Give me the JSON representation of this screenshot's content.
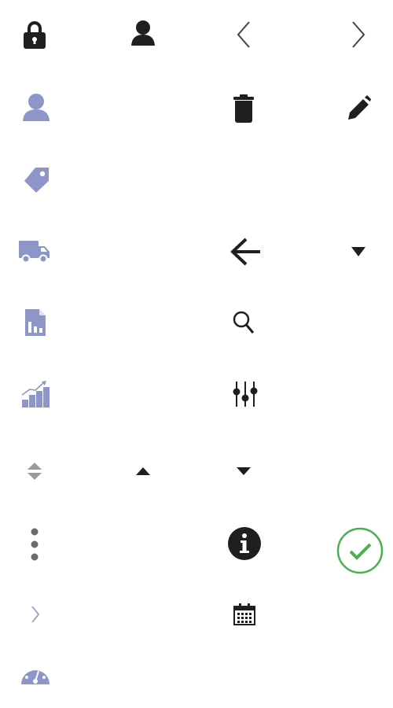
{
  "icons": [
    {
      "name": "lock-icon",
      "color": "#1f1f1f"
    },
    {
      "name": "user-icon",
      "color": "#1f1f1f"
    },
    {
      "name": "chevron-left-icon",
      "color": "#444444"
    },
    {
      "name": "chevron-right-icon",
      "color": "#444444"
    },
    {
      "name": "user-icon",
      "color": "#8d95c9"
    },
    {
      "name": "trash-icon",
      "color": "#1f1f1f"
    },
    {
      "name": "pencil-icon",
      "color": "#1f1f1f"
    },
    {
      "name": "tag-icon",
      "color": "#8d95c9"
    },
    {
      "name": "truck-icon",
      "color": "#8d95c9"
    },
    {
      "name": "arrow-left-icon",
      "color": "#1f1f1f"
    },
    {
      "name": "caret-down-icon",
      "color": "#1f1f1f"
    },
    {
      "name": "report-document-icon",
      "color": "#8d95c9"
    },
    {
      "name": "search-icon",
      "color": "#1f1f1f"
    },
    {
      "name": "growth-chart-icon",
      "color": "#8d95c9"
    },
    {
      "name": "sliders-icon",
      "color": "#1f1f1f"
    },
    {
      "name": "sort-icon",
      "color": "#9a9a9a"
    },
    {
      "name": "caret-up-icon",
      "color": "#1f1f1f"
    },
    {
      "name": "caret-down-icon",
      "color": "#1f1f1f"
    },
    {
      "name": "kebab-menu-icon",
      "color": "#6b6b6b"
    },
    {
      "name": "info-icon",
      "color": "#1f1f1f"
    },
    {
      "name": "check-circle-icon",
      "color": "#4caf50"
    },
    {
      "name": "chevron-right-small-icon",
      "color": "#8d95c9"
    },
    {
      "name": "calendar-icon",
      "color": "#1f1f1f"
    },
    {
      "name": "dashboard-gauge-icon",
      "color": "#8d95c9"
    }
  ]
}
